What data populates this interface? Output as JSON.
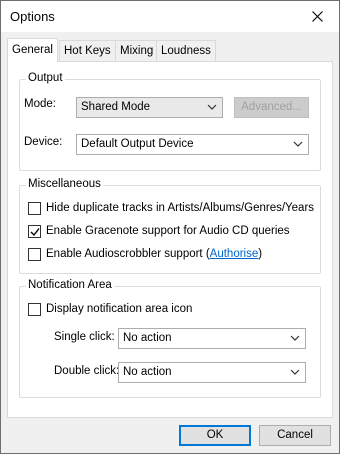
{
  "window": {
    "title": "Options",
    "close_label": "✕"
  },
  "tabs": [
    {
      "label": "General",
      "active": true
    },
    {
      "label": "Hot Keys",
      "active": false
    },
    {
      "label": "Mixing",
      "active": false
    },
    {
      "label": "Loudness",
      "active": false
    }
  ],
  "output": {
    "group_label": "Output",
    "mode_label": "Mode:",
    "mode_value": "Shared Mode",
    "advanced_label": "Advanced...",
    "device_label": "Device:",
    "device_value": "Default Output Device"
  },
  "misc": {
    "group_label": "Miscellaneous",
    "options": [
      {
        "label": "Hide duplicate tracks in Artists/Albums/Genres/Years",
        "checked": false
      },
      {
        "label": "Enable Gracenote support for Audio CD queries",
        "checked": true
      },
      {
        "label": "Enable Audioscrobbler support (",
        "link": "Authorise",
        "suffix": ")",
        "checked": false
      }
    ]
  },
  "notification": {
    "group_label": "Notification Area",
    "display_icon_label": "Display notification area icon",
    "display_icon_checked": false,
    "single_click_label": "Single click:",
    "single_click_value": "No action",
    "double_click_label": "Double click:",
    "double_click_value": "No action"
  },
  "footer": {
    "ok_label": "OK",
    "cancel_label": "Cancel"
  }
}
